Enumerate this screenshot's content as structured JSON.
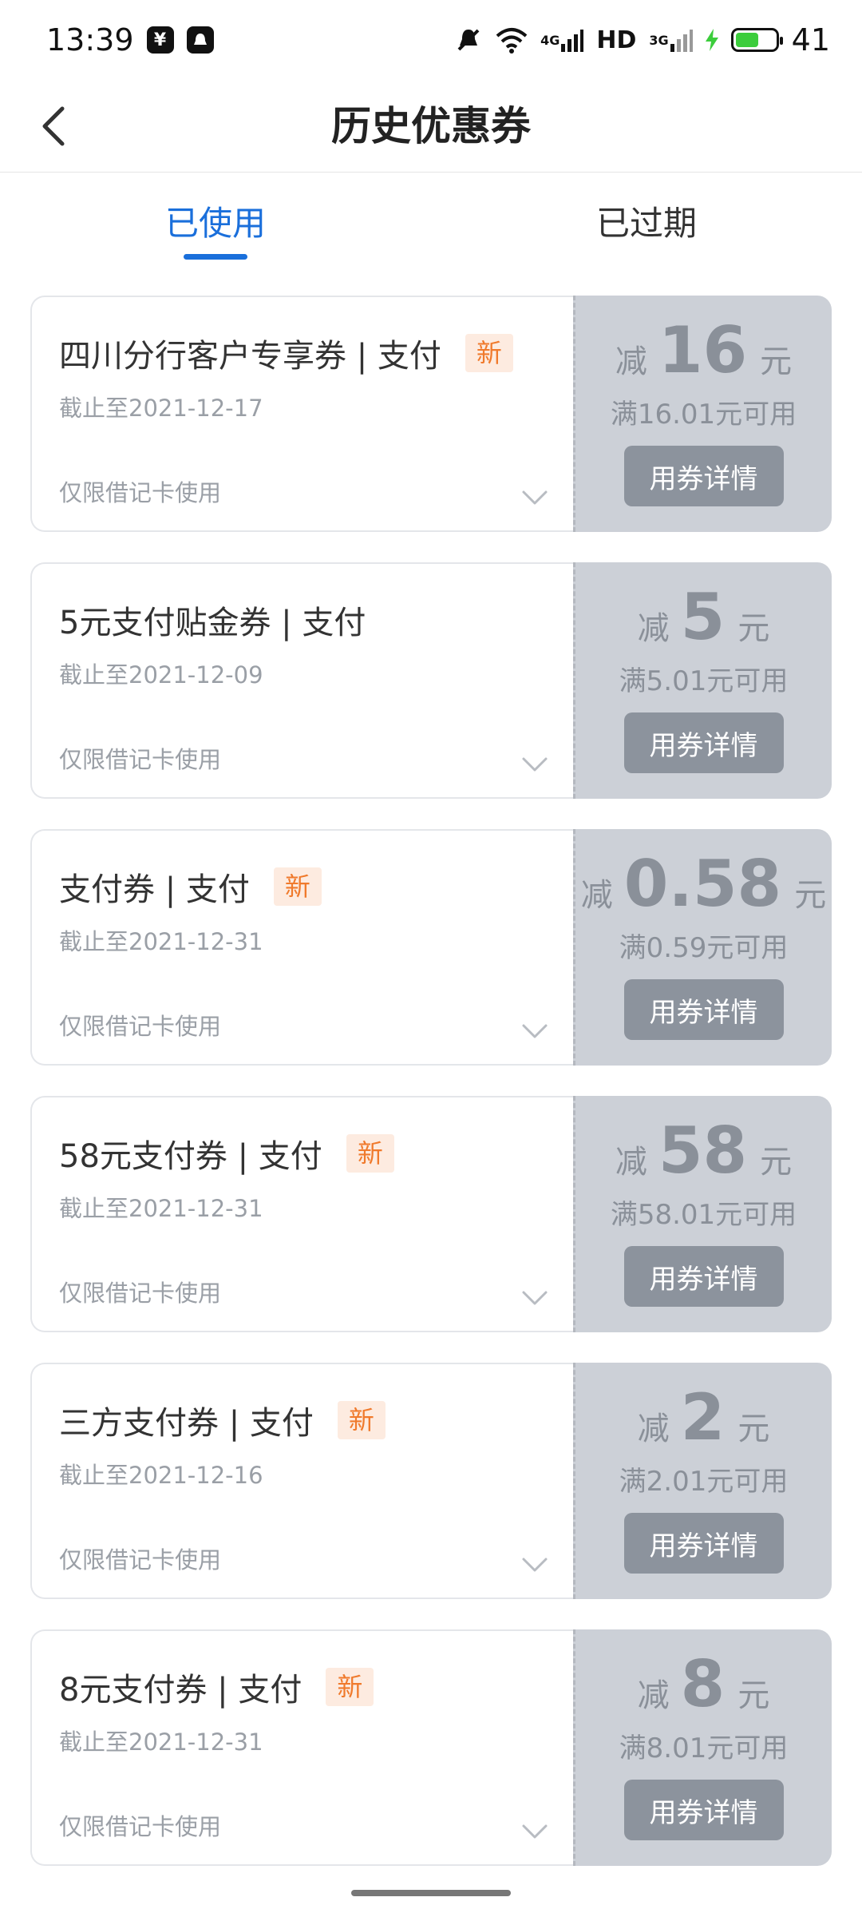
{
  "status_bar": {
    "time": "13:39",
    "network_4g": "4G",
    "hd": "HD",
    "network_3g": "3G",
    "battery": "41",
    "icons": [
      "shield-yen-icon",
      "notification-app-icon",
      "mute-bell-icon",
      "wifi-icon",
      "signal-4g-icon",
      "signal-3g-icon",
      "charging-icon",
      "battery-icon"
    ]
  },
  "header": {
    "title": "历史优惠券"
  },
  "tabs": [
    {
      "label": "已使用",
      "active": true
    },
    {
      "label": "已过期",
      "active": false
    }
  ],
  "coupons": [
    {
      "name": "四川分行客户专享券 | 支付",
      "badge": "新",
      "expiry": "截止至2021-12-17",
      "restriction": "仅限借记卡使用",
      "prefix": "减",
      "amount": "16",
      "unit": "元",
      "min_spend": "满16.01元可用",
      "button": "用券详情"
    },
    {
      "name": "5元支付贴金券 | 支付",
      "badge": "",
      "expiry": "截止至2021-12-09",
      "restriction": "仅限借记卡使用",
      "prefix": "减",
      "amount": "5",
      "unit": "元",
      "min_spend": "满5.01元可用",
      "button": "用券详情"
    },
    {
      "name": "支付券 | 支付",
      "badge": "新",
      "expiry": "截止至2021-12-31",
      "restriction": "仅限借记卡使用",
      "prefix": "减",
      "amount": "0.58",
      "unit": "元",
      "min_spend": "满0.59元可用",
      "button": "用券详情"
    },
    {
      "name": "58元支付券 | 支付",
      "badge": "新",
      "expiry": "截止至2021-12-31",
      "restriction": "仅限借记卡使用",
      "prefix": "减",
      "amount": "58",
      "unit": "元",
      "min_spend": "满58.01元可用",
      "button": "用券详情"
    },
    {
      "name": "三方支付券 | 支付",
      "badge": "新",
      "expiry": "截止至2021-12-16",
      "restriction": "仅限借记卡使用",
      "prefix": "减",
      "amount": "2",
      "unit": "元",
      "min_spend": "满2.01元可用",
      "button": "用券详情"
    },
    {
      "name": "8元支付券 | 支付",
      "badge": "新",
      "expiry": "截止至2021-12-31",
      "restriction": "仅限借记卡使用",
      "prefix": "减",
      "amount": "8",
      "unit": "元",
      "min_spend": "满8.01元可用",
      "button": "用券详情"
    }
  ],
  "colors": {
    "accent": "#1a6fdb",
    "badge_text": "#f07a2c",
    "badge_bg": "#fdebe0",
    "coupon_right_bg": "#ccd0d7",
    "button_bg": "#8c939d"
  }
}
